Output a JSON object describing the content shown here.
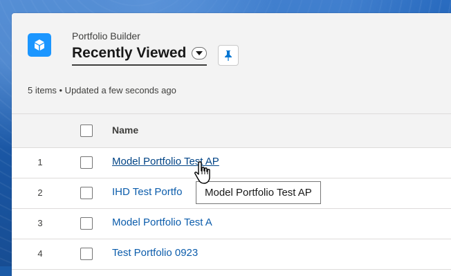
{
  "header": {
    "app_name": "Portfolio Builder",
    "list_title": "Recently Viewed",
    "meta": "5 items • Updated a few seconds ago",
    "icons": [
      "portfolio-app-icon",
      "chevron-down-icon",
      "pin-icon"
    ]
  },
  "table": {
    "columns": [
      "Name"
    ],
    "rows": [
      {
        "num": "1",
        "name": "Model Portfolio Test AP"
      },
      {
        "num": "2",
        "name": "IHD Test Portfo"
      },
      {
        "num": "3",
        "name": "Model Portfolio Test A"
      },
      {
        "num": "4",
        "name": "Test Portfolio 0923"
      }
    ]
  },
  "tooltip": {
    "text": "Model Portfolio Test AP"
  },
  "colors": {
    "brand": "#1b96ff",
    "link": "#0b5cab",
    "background": "#1b5aa6"
  }
}
